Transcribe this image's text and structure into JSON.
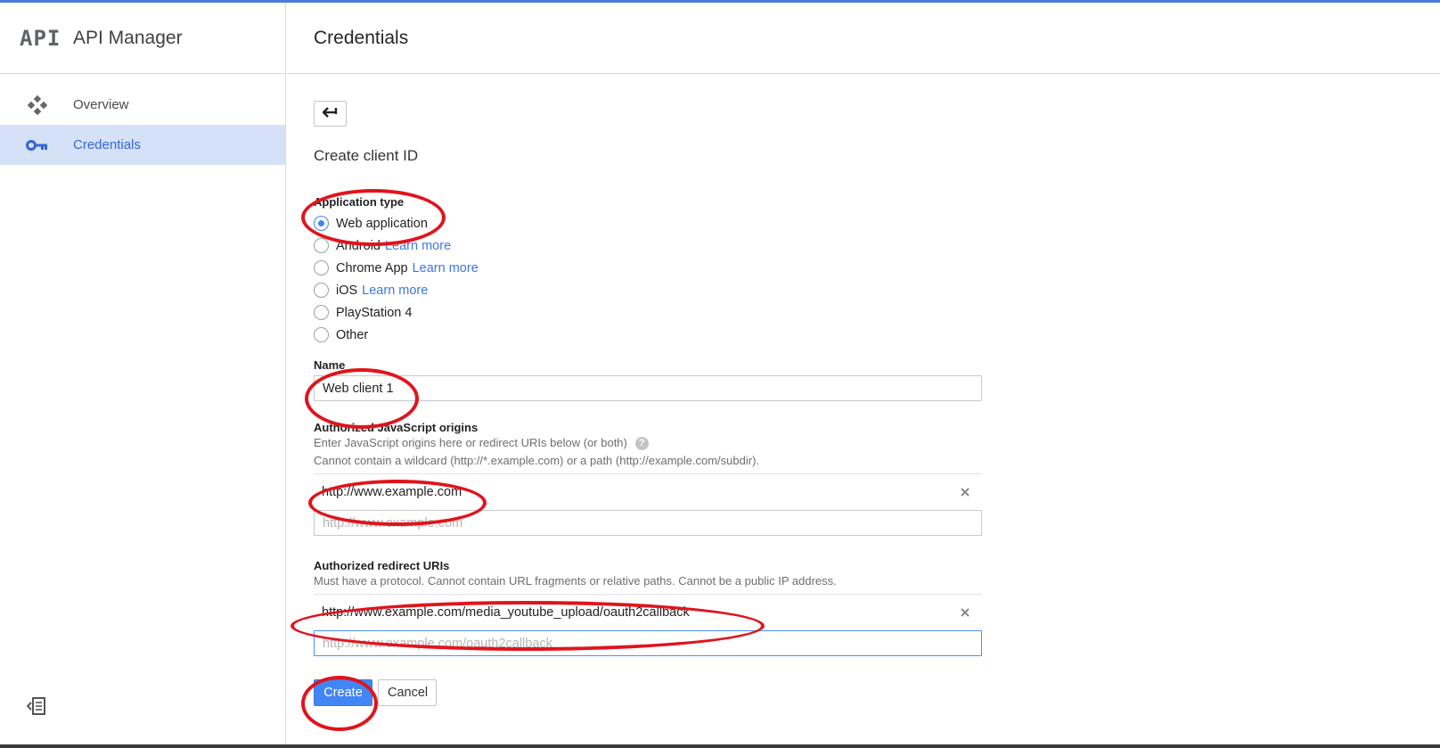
{
  "app": {
    "logo_text": "API",
    "title": "API Manager"
  },
  "sidebar": {
    "items": [
      {
        "label": "Overview",
        "icon": "overview-diamond-icon",
        "active": false
      },
      {
        "label": "Credentials",
        "icon": "key-icon",
        "active": true
      }
    ],
    "collapse_icon": "collapse-sidebar-icon"
  },
  "header": {
    "title": "Credentials"
  },
  "form": {
    "back_icon": "back-arrow-icon",
    "title": "Create client ID",
    "application_type": {
      "label": "Application type",
      "options": [
        {
          "label": "Web application",
          "link": "",
          "checked": true
        },
        {
          "label": "Android",
          "link": "Learn more",
          "checked": false
        },
        {
          "label": "Chrome App",
          "link": "Learn more",
          "checked": false
        },
        {
          "label": "iOS",
          "link": "Learn more",
          "checked": false
        },
        {
          "label": "PlayStation 4",
          "link": "",
          "checked": false
        },
        {
          "label": "Other",
          "link": "",
          "checked": false
        }
      ]
    },
    "name": {
      "label": "Name",
      "value": "Web client 1"
    },
    "js_origins": {
      "label": "Authorized JavaScript origins",
      "help1": "Enter JavaScript origins here or redirect URIs below (or both)",
      "help_icon": "?",
      "help2": "Cannot contain a wildcard (http://*.example.com) or a path (http://example.com/subdir).",
      "entries": [
        "http://www.example.com"
      ],
      "placeholder": "http://www.example.com"
    },
    "redirect_uris": {
      "label": "Authorized redirect URIs",
      "help": "Must have a protocol. Cannot contain URL fragments or relative paths. Cannot be a public IP address.",
      "entries": [
        "http://www.example.com/media_youtube_upload/oauth2callback"
      ],
      "placeholder": "http://www.example.com/oauth2callback"
    },
    "actions": {
      "create_label": "Create",
      "cancel_label": "Cancel"
    }
  },
  "colors": {
    "accent": "#4285f4",
    "link": "#3b78e7",
    "active_nav_bg": "#d5e1f6",
    "annotation": "#e0141c"
  }
}
